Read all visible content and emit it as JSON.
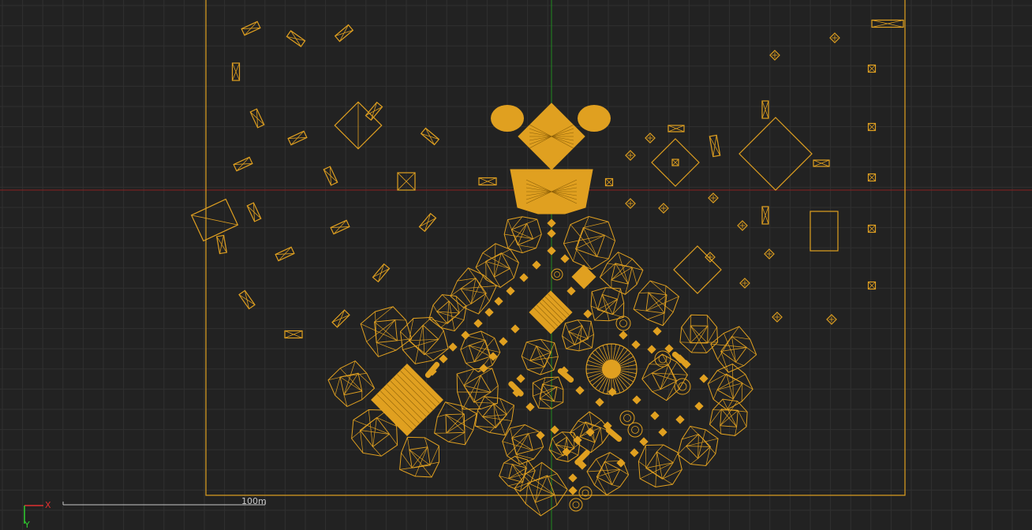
{
  "viewport": {
    "name": "top-view-viewport",
    "background": "#222222",
    "grid_color": "#303030",
    "wire_color": "#e0a020",
    "x_axis_color": "#b02020",
    "y_axis_color": "#20a020"
  },
  "gizmo": {
    "x_label": "X",
    "y_label": "Y"
  },
  "scale_bar": {
    "label": "100m"
  }
}
